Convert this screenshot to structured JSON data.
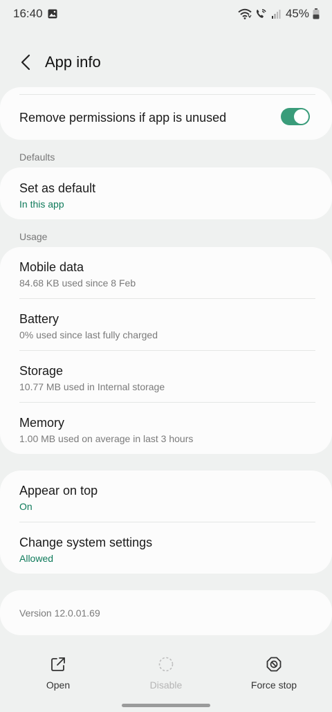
{
  "status_bar": {
    "time": "16:40",
    "battery_percent": "45%",
    "icons": [
      "gallery-icon",
      "wifi-icon",
      "wifi-calling-icon",
      "signal-icon",
      "battery-icon"
    ]
  },
  "header": {
    "title": "App info",
    "back_icon": "chevron-left-icon"
  },
  "permissions_card": {
    "label": "Remove permissions if app is unused",
    "toggle_on": true,
    "accent_color": "#3a9c7a"
  },
  "defaults": {
    "section_label": "Defaults",
    "item": {
      "title": "Set as default",
      "subtitle": "In this app"
    }
  },
  "usage": {
    "section_label": "Usage",
    "items": [
      {
        "title": "Mobile data",
        "subtitle": "84.68 KB used since 8 Feb"
      },
      {
        "title": "Battery",
        "subtitle": "0% used since last fully charged"
      },
      {
        "title": "Storage",
        "subtitle": "10.77 MB used in Internal storage"
      },
      {
        "title": "Memory",
        "subtitle": "1.00 MB used on average in last 3 hours"
      }
    ]
  },
  "advanced": {
    "items": [
      {
        "title": "Appear on top",
        "subtitle": "On"
      },
      {
        "title": "Change system settings",
        "subtitle": "Allowed"
      }
    ]
  },
  "version": {
    "text": "Version 12.0.01.69"
  },
  "bottom_actions": [
    {
      "label": "Open",
      "icon": "open-external-icon",
      "enabled": true
    },
    {
      "label": "Disable",
      "icon": "disable-icon",
      "enabled": false
    },
    {
      "label": "Force stop",
      "icon": "force-stop-icon",
      "enabled": true
    }
  ],
  "colors": {
    "background": "#eff1f0",
    "card": "#fcfcfc",
    "accent_text": "#0e7a5a"
  }
}
